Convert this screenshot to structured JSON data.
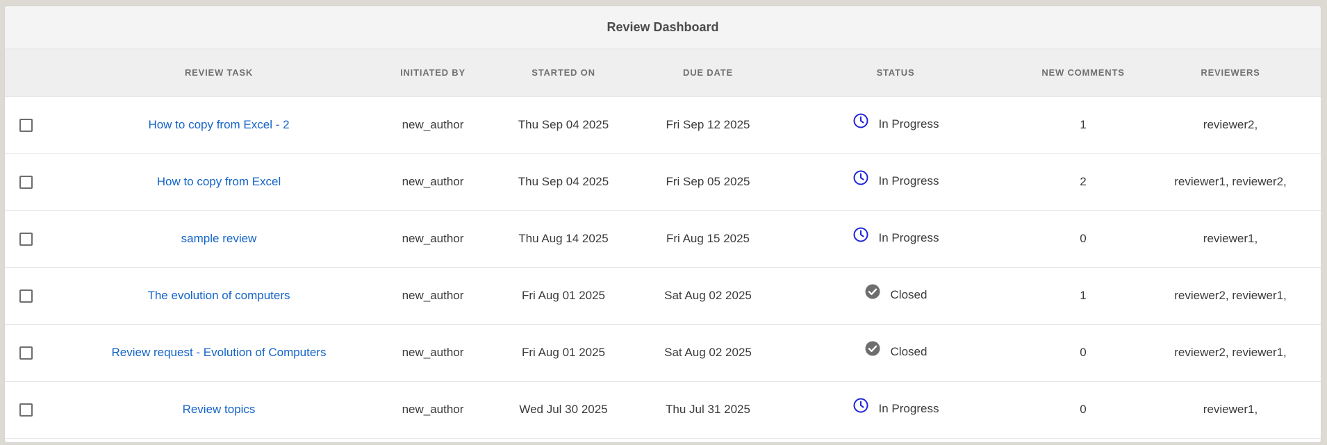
{
  "dashboard": {
    "title": "Review Dashboard"
  },
  "columns": {
    "review_task": "REVIEW TASK",
    "initiated_by": "INITIATED BY",
    "started_on": "STARTED ON",
    "due_date": "DUE DATE",
    "status": "STATUS",
    "new_comments": "NEW COMMENTS",
    "reviewers": "REVIEWERS"
  },
  "colors": {
    "link": "#1464c8",
    "in_progress_icon": "#1f24d8",
    "closed_icon": "#6e6e6e"
  },
  "rows": [
    {
      "task": "How to copy from Excel - 2",
      "initiated_by": "new_author",
      "started_on": "Thu Sep 04 2025",
      "due_date": "Fri Sep 12 2025",
      "status": "In Progress",
      "status_icon": "clock-icon",
      "new_comments": "1",
      "reviewers": "reviewer2,"
    },
    {
      "task": "How to copy from Excel",
      "initiated_by": "new_author",
      "started_on": "Thu Sep 04 2025",
      "due_date": "Fri Sep 05 2025",
      "status": "In Progress",
      "status_icon": "clock-icon",
      "new_comments": "2",
      "reviewers": "reviewer1, reviewer2,"
    },
    {
      "task": "sample review",
      "initiated_by": "new_author",
      "started_on": "Thu Aug 14 2025",
      "due_date": "Fri Aug 15 2025",
      "status": "In Progress",
      "status_icon": "clock-icon",
      "new_comments": "0",
      "reviewers": "reviewer1,"
    },
    {
      "task": "The evolution of computers",
      "initiated_by": "new_author",
      "started_on": "Fri Aug 01 2025",
      "due_date": "Sat Aug 02 2025",
      "status": "Closed",
      "status_icon": "checkmark-circle-icon",
      "new_comments": "1",
      "reviewers": "reviewer2, reviewer1,"
    },
    {
      "task": "Review request - Evolution of Computers",
      "initiated_by": "new_author",
      "started_on": "Fri Aug 01 2025",
      "due_date": "Sat Aug 02 2025",
      "status": "Closed",
      "status_icon": "checkmark-circle-icon",
      "new_comments": "0",
      "reviewers": "reviewer2, reviewer1,"
    },
    {
      "task": "Review topics",
      "initiated_by": "new_author",
      "started_on": "Wed Jul 30 2025",
      "due_date": "Thu Jul 31 2025",
      "status": "In Progress",
      "status_icon": "clock-icon",
      "new_comments": "0",
      "reviewers": "reviewer1,"
    }
  ]
}
